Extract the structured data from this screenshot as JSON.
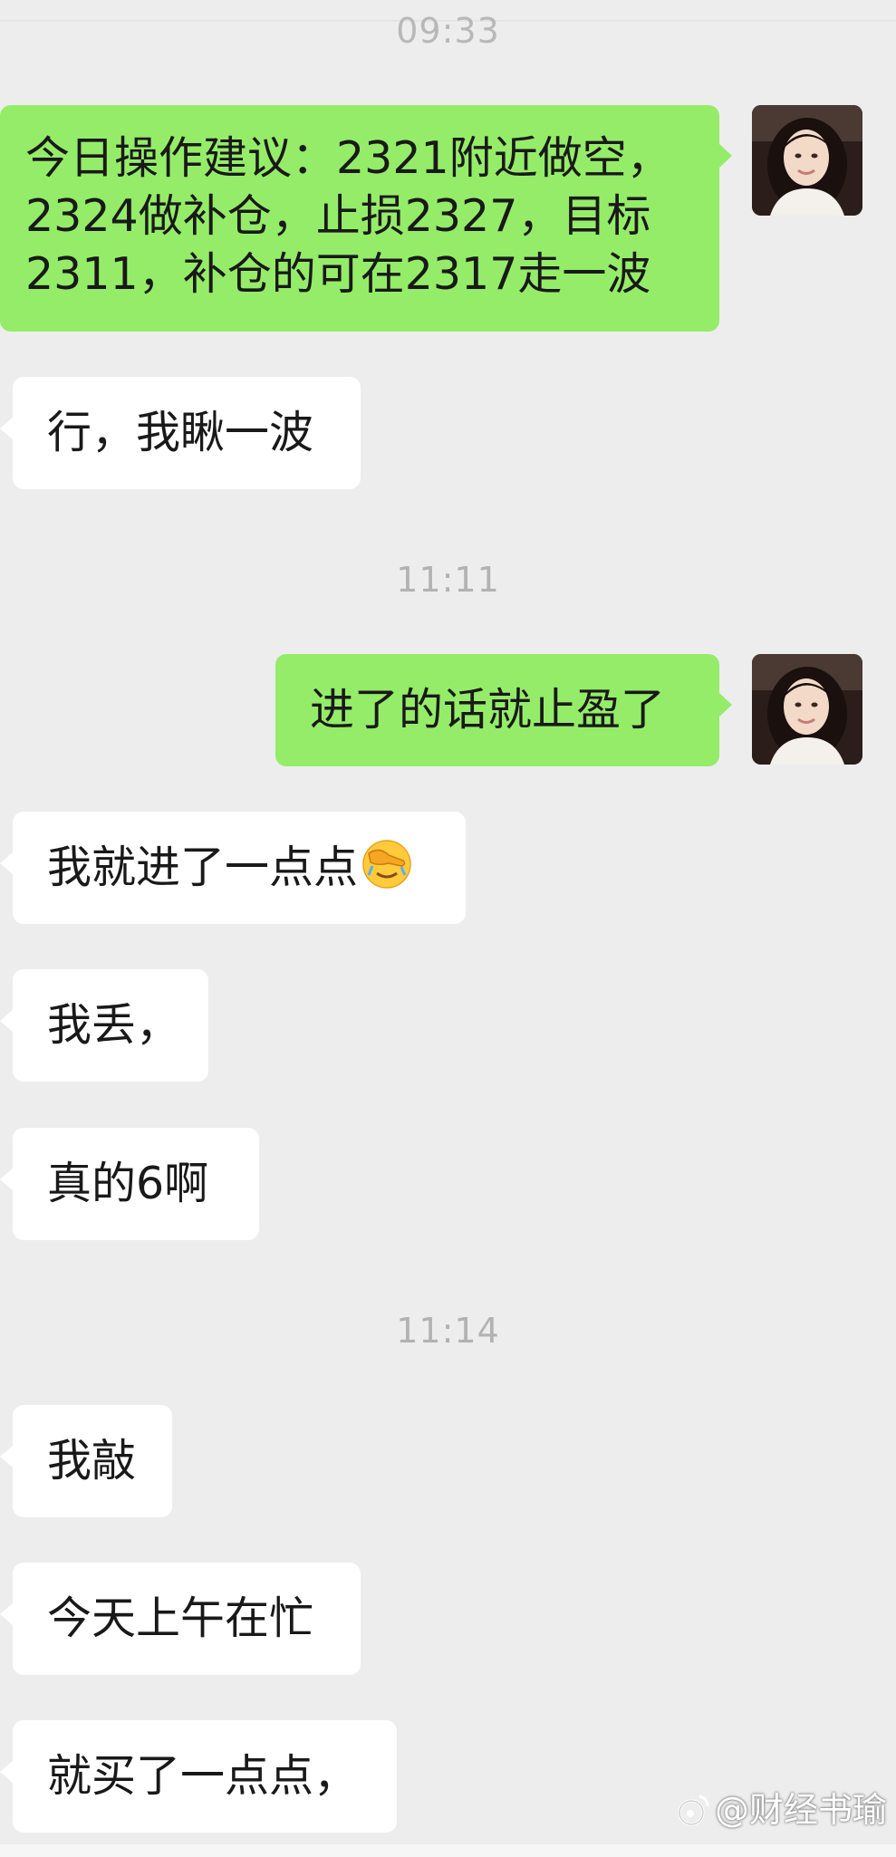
{
  "timestamps": [
    "09:33",
    "11:11",
    "11:14"
  ],
  "messages": [
    {
      "side": "out",
      "lines": [
        "今日操作建议：2321附近做空，",
        "2324做补仓，止损2327，目标",
        "2311，补仓的可在2317走一波"
      ]
    },
    {
      "side": "in",
      "text": "行，我瞅一波"
    },
    {
      "side": "out",
      "text": "进了的话就止盈了"
    },
    {
      "side": "in",
      "text": "我就进了一点点",
      "emoji": "face-with-hand-over-eyes-emoji"
    },
    {
      "side": "in",
      "text": "我丢，"
    },
    {
      "side": "in",
      "text": "真的6啊"
    },
    {
      "side": "in",
      "text": "我敲"
    },
    {
      "side": "in",
      "text": "今天上午在忙"
    },
    {
      "side": "in",
      "text": "就买了一点点，"
    }
  ],
  "avatar": {
    "icon": "user-avatar-photo"
  },
  "watermark": {
    "text": "@财经书瑜",
    "icon": "weibo-logo-icon"
  },
  "colors": {
    "background": "#ededed",
    "outgoing_bubble": "#95ec69",
    "incoming_bubble": "#ffffff",
    "timestamp_text": "#b2b2b2"
  }
}
